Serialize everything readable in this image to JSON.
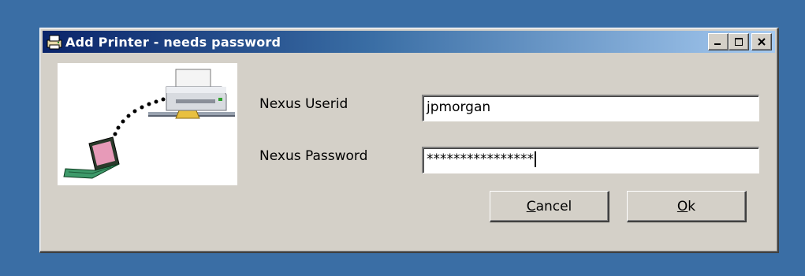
{
  "window": {
    "title": "Add Printer - needs password",
    "icon": "printer-window-icon",
    "controls": [
      "minimize-icon",
      "maximize-icon",
      "close-icon"
    ]
  },
  "form": {
    "userid_label": "Nexus Userid",
    "userid_value": "jpmorgan",
    "password_label": "Nexus Password",
    "password_value": "****************"
  },
  "buttons": {
    "cancel": {
      "mnemonic": "C",
      "rest": "ancel"
    },
    "ok": {
      "mnemonic": "O",
      "rest": "k"
    }
  },
  "illustration": {
    "icons": [
      "printer-icon",
      "laptop-icon"
    ]
  },
  "colors": {
    "desktop": "#3a6ea5",
    "title_start": "#0a246a",
    "title_end": "#a6caf0",
    "face": "#d4d0c8"
  }
}
